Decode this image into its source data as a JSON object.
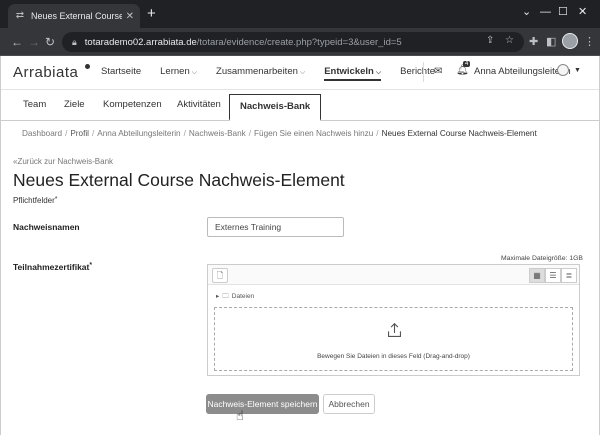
{
  "browser": {
    "tab_title": "Neues External Course Nachwe",
    "url_host": "totarademo02.arrabiata.de",
    "url_path": "/totara/evidence/create.php?typeid=3&user_id=5",
    "icons": [
      "back-arrow-icon",
      "forward-arrow-icon",
      "reload-icon",
      "lock-icon",
      "share-icon",
      "star-icon",
      "extension-icon",
      "sidepanel-icon",
      "profile-icon",
      "menu-icon"
    ]
  },
  "header": {
    "logo": "Arrabiata",
    "nav": [
      {
        "label": "Startseite",
        "has_caret": false
      },
      {
        "label": "Lernen",
        "has_caret": true
      },
      {
        "label": "Zusammenarbeiten",
        "has_caret": true
      },
      {
        "label": "Entwickeln",
        "has_caret": true,
        "active": true
      },
      {
        "label": "Berichte",
        "has_caret": false
      }
    ],
    "notification_count": "4",
    "username": "Anna Abteilungsleiterin"
  },
  "subnav": {
    "tabs": [
      {
        "label": "Team"
      },
      {
        "label": "Ziele"
      },
      {
        "label": "Kompetenzen"
      },
      {
        "label": "Aktivitäten"
      },
      {
        "label": "Nachweis-Bank",
        "active": true
      }
    ]
  },
  "breadcrumb": [
    "Dashboard",
    "Profil",
    "Anna Abteilungsleiterin",
    "Nachweis-Bank",
    "Fügen Sie einen Nachweis hinzu",
    "Neues External Course Nachweis-Element"
  ],
  "page": {
    "back_link": "«Zurück zur Nachweis-Bank",
    "title": "Neues External Course Nachweis-Element",
    "required_note": "Pflichtfelder",
    "required_mark": "*"
  },
  "form": {
    "name_label": "Nachweisnamen",
    "name_value": "Externes Training",
    "cert_label": "Teilnahmezertifikat",
    "max_size": "Maximale Dateigröße: 1GB",
    "files_path": "Dateien",
    "dropzone_text": "Bewegen Sie Dateien in dieses Feld (Drag-and-drop)",
    "save_label": "Nachweis-Element speichern",
    "cancel_label": "Abbrechen"
  },
  "colors": {
    "chrome_dark": "#202124",
    "tab_bg": "#35363a",
    "save_button": "#8c8c8c"
  }
}
